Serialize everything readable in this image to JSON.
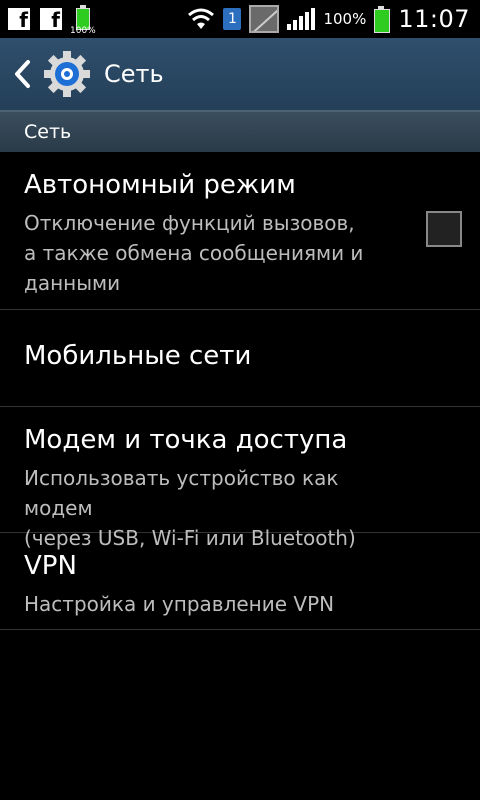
{
  "statusbar": {
    "small_battery_label": "100%",
    "notification_badge": "1",
    "battery_percent": "100%",
    "time": "11:07",
    "facebook_glyph": "f"
  },
  "actionbar": {
    "title": "Сеть"
  },
  "section": {
    "header": "Сеть"
  },
  "items": [
    {
      "title": "Автономный режим",
      "subtitle_lines": [
        "Отключение функций вызовов,",
        "а также обмена сообщениями и",
        "данными"
      ],
      "checked": false
    },
    {
      "title": "Мобильные сети"
    },
    {
      "title": "Модем и точка доступа",
      "subtitle_lines": [
        "Использовать устройство как модем",
        "(через USB, Wi-Fi или Bluetooth)"
      ]
    },
    {
      "title": "VPN",
      "subtitle_lines": [
        "Настройка и управление VPN"
      ]
    }
  ],
  "colors": {
    "actionbar": "#2f4f6d",
    "section_header": "#3a4e5e",
    "battery_green": "#2ecc21",
    "badge_blue": "#2d6fbf"
  }
}
